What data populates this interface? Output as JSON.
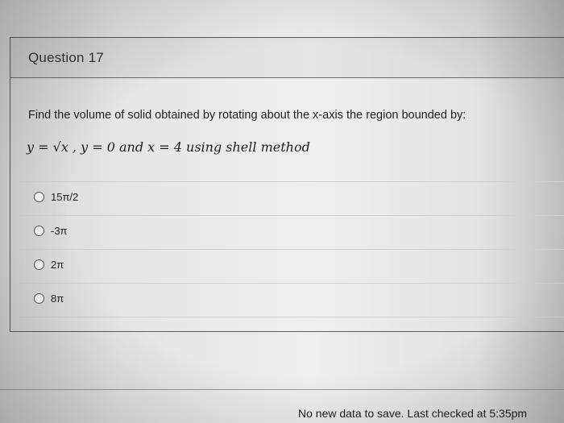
{
  "question": {
    "title": "Question 17",
    "text": "Find the volume of solid obtained by rotating about the x-axis the region bounded by:",
    "formula": "y = √x , y = 0 and x = 4 using shell method"
  },
  "options": [
    {
      "label": "15π/2"
    },
    {
      "label": "-3π"
    },
    {
      "label": "2π"
    },
    {
      "label": "8π"
    }
  ],
  "footer": {
    "status": "No new data to save. Last checked at 5:35pm"
  },
  "colors": {
    "background": "#e6e6e6",
    "border": "#5a5a5a",
    "text": "#222222"
  }
}
